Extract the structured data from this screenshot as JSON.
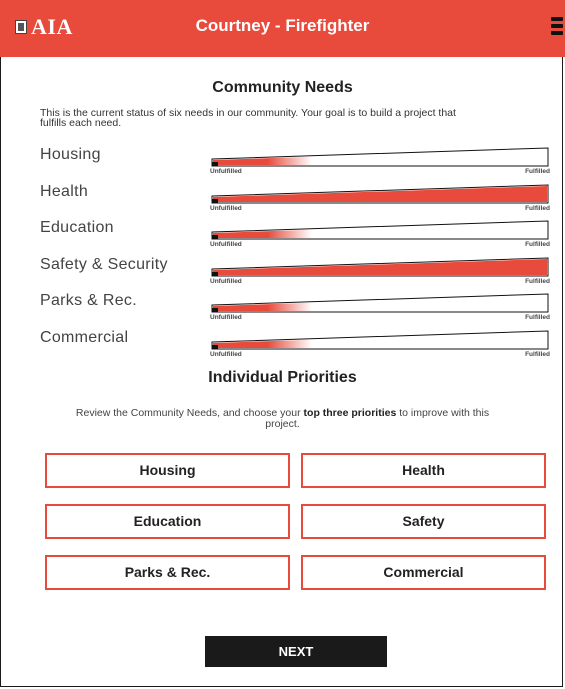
{
  "header": {
    "logo_text": "AIA",
    "title": "Courtney - Firefighter"
  },
  "community": {
    "title": "Community Needs",
    "intro_line1": "This is the current status of six needs in our community. Your goal is to build a project that",
    "intro_line2": "fulfills each need.",
    "scale_low": "Unfulfilled",
    "scale_high": "Fulfilled",
    "needs": [
      {
        "label": "Housing",
        "level": 0.3
      },
      {
        "label": "Health",
        "level": 1.0
      },
      {
        "label": "Education",
        "level": 0.3
      },
      {
        "label": "Safety & Security",
        "level": 1.0
      },
      {
        "label": "Parks & Rec.",
        "level": 0.3
      },
      {
        "label": "Commercial",
        "level": 0.3
      }
    ]
  },
  "priorities": {
    "title": "Individual Priorities",
    "note_pre": "Review the Community Needs, and choose your",
    "note_bold": "top three priorities",
    "note_post": "to improve with this",
    "note_line2": "project.",
    "buttons": [
      "Housing",
      "Health",
      "Education",
      "Safety",
      "Parks & Rec.",
      "Commercial"
    ]
  },
  "next_label": "NEXT",
  "colors": {
    "accent": "#e84a3c",
    "dark": "#1a1a1a"
  }
}
